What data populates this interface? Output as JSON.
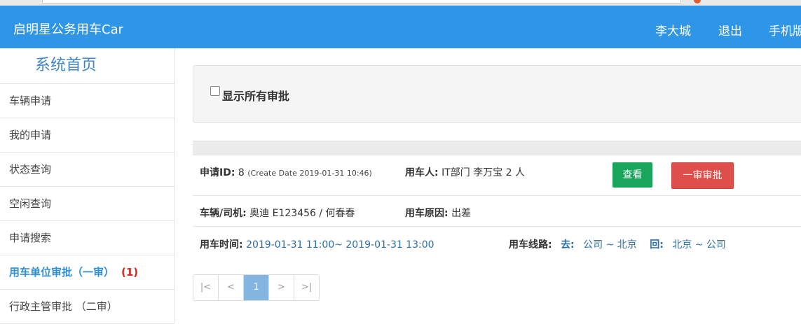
{
  "header": {
    "brand": "启明星公务用车Car",
    "user": "李大城",
    "logout": "退出",
    "mobile": "手机版"
  },
  "sidebar": {
    "title": "系统首页",
    "items": [
      {
        "label": "车辆申请"
      },
      {
        "label": "我的申请"
      },
      {
        "label": "状态查询"
      },
      {
        "label": "空闲查询"
      },
      {
        "label": "申请搜索"
      },
      {
        "label": "用车单位审批（一审）",
        "badge": "(1)"
      },
      {
        "label": "行政主管审批 （二审）"
      }
    ]
  },
  "filter": {
    "show_all_label": "显示所有审批",
    "checked": false
  },
  "request": {
    "id_label": "申请ID:",
    "id_value": "8",
    "create_date": "(Create Date 2019-01-31 10:46)",
    "user_label": "用车人:",
    "user_value": "IT部门 李万宝 2 人",
    "vehicle_label": "车辆/司机:",
    "vehicle_value": "奥迪 E123456 / 何春春",
    "reason_label": "用车原因:",
    "reason_value": "出差",
    "time_label": "用车时间:",
    "time_value": "2019-01-31 11:00~ 2019-01-31 13:00",
    "route_label": "用车线路:",
    "go_label": "去:",
    "go_value": "公司 ~ 北京",
    "back_label": "回:",
    "back_value": "北京 ~ 公司",
    "view_button": "查看",
    "approve_button": "一审审批"
  },
  "pagination": {
    "first": "|<",
    "prev": "<",
    "current": "1",
    "next": ">",
    "last": ">|"
  },
  "colors": {
    "navbar": "#2f95e6",
    "view_button": "#19a55b",
    "approve_button": "#de4f4b",
    "active_page": "#84b5e1"
  }
}
